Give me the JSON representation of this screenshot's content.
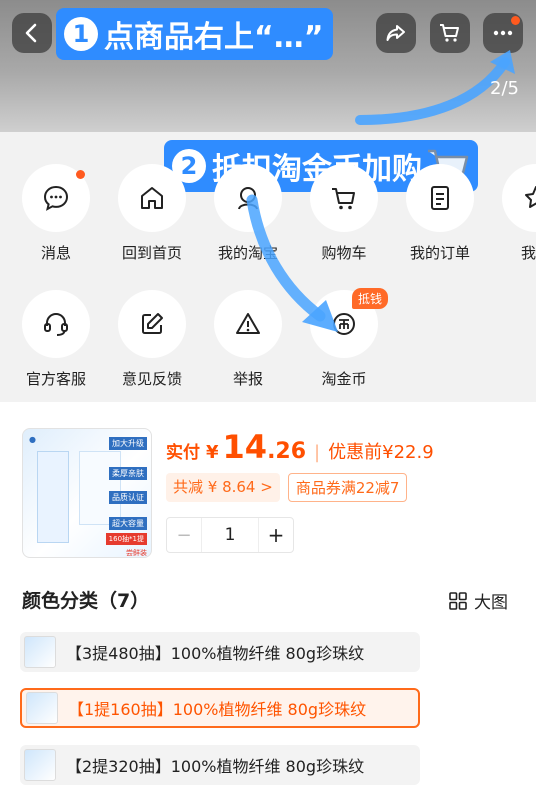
{
  "header": {
    "annotation_step1": "点商品右上“…”",
    "annotation_num1": "1",
    "page_indicator": "2/5"
  },
  "sheet": {
    "annotation_step2": "抵扣淘金币加购",
    "annotation_num2": "2",
    "row1": [
      {
        "label": "消息",
        "icon": "chat-icon"
      },
      {
        "label": "回到首页",
        "icon": "home-icon"
      },
      {
        "label": "我的淘宝",
        "icon": "user-icon"
      },
      {
        "label": "购物车",
        "icon": "cart-icon"
      },
      {
        "label": "我的订单",
        "icon": "order-icon"
      },
      {
        "label": "我的",
        "icon": "star-icon"
      }
    ],
    "row2": [
      {
        "label": "官方客服",
        "icon": "headset-icon"
      },
      {
        "label": "意见反馈",
        "icon": "edit-icon"
      },
      {
        "label": "举报",
        "icon": "warning-icon"
      },
      {
        "label": "淘金币",
        "icon": "coin-icon",
        "badge": "抵钱"
      }
    ]
  },
  "product": {
    "price_prefix": "实付",
    "currency": "¥",
    "price_int": "14",
    "price_dec": ".26",
    "before_label": "优惠前",
    "before_price": "¥22.9",
    "saving": "共减 ¥ 8.64 >",
    "coupon": "商品券满22减7",
    "qty_minus": "−",
    "qty": "1",
    "qty_plus": "+",
    "thumb_tags": [
      "加大升级",
      "柔厚亲肤",
      "品质认证",
      "超大容量",
      "160抽*1提",
      "尝鲜装"
    ]
  },
  "variants": {
    "title": "颜色分类（7）",
    "bigview": "大图",
    "items": [
      {
        "label": "【3提480抽】100%植物纤维 80g珍珠纹",
        "selected": false
      },
      {
        "label": "【1提160抽】100%植物纤维 80g珍珠纹",
        "selected": true
      },
      {
        "label": "【2提320抽】100%植物纤维 80g珍珠纹",
        "selected": false
      }
    ]
  },
  "colors": {
    "accent_blue": "#2f8cff",
    "accent_orange": "#ff4f00"
  }
}
